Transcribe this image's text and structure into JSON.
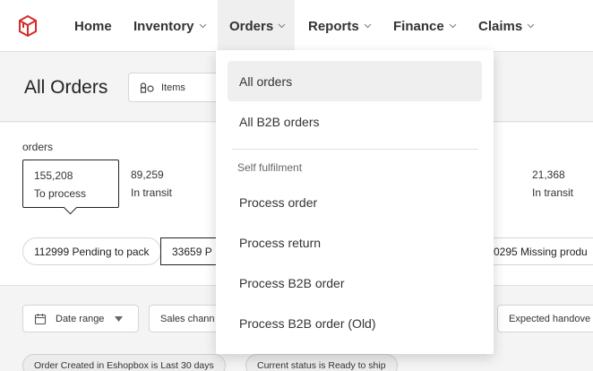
{
  "nav": {
    "items": [
      {
        "label": "Home",
        "has_chevron": false
      },
      {
        "label": "Inventory",
        "has_chevron": true
      },
      {
        "label": "Orders",
        "has_chevron": true,
        "active": true
      },
      {
        "label": "Reports",
        "has_chevron": true
      },
      {
        "label": "Finance",
        "has_chevron": true
      },
      {
        "label": "Claims",
        "has_chevron": true
      }
    ],
    "logo_color": "#d42b2b"
  },
  "header": {
    "title": "All Orders",
    "items_select": {
      "label": "Items",
      "icon": "items-icon"
    }
  },
  "summary": {
    "label": "orders",
    "stats": [
      {
        "value": "155,208",
        "label": "To process",
        "selected": true
      },
      {
        "value": "89,259",
        "label": "In transit"
      },
      {
        "value": "21,368",
        "label": "In transit"
      }
    ],
    "pills": [
      {
        "text": "112999 Pending to pack"
      },
      {
        "text": "33659 P"
      },
      {
        "text": "0295 Missing produ"
      }
    ]
  },
  "filters": {
    "date_range": "Date range",
    "sales_channel": "Sales chann",
    "expected_handover": "Expected handove",
    "chips": [
      {
        "text": "Order Created in Eshopbox is Last 30 days"
      },
      {
        "text": "Current status is Ready to ship"
      }
    ]
  },
  "dropdown": {
    "items": [
      {
        "label": "All orders",
        "hover": true
      },
      {
        "label": "All B2B orders"
      }
    ],
    "section_label": "Self fulfilment",
    "section_items": [
      {
        "label": "Process order"
      },
      {
        "label": "Process return"
      },
      {
        "label": "Process B2B order"
      },
      {
        "label": "Process B2B order (Old)"
      }
    ]
  }
}
